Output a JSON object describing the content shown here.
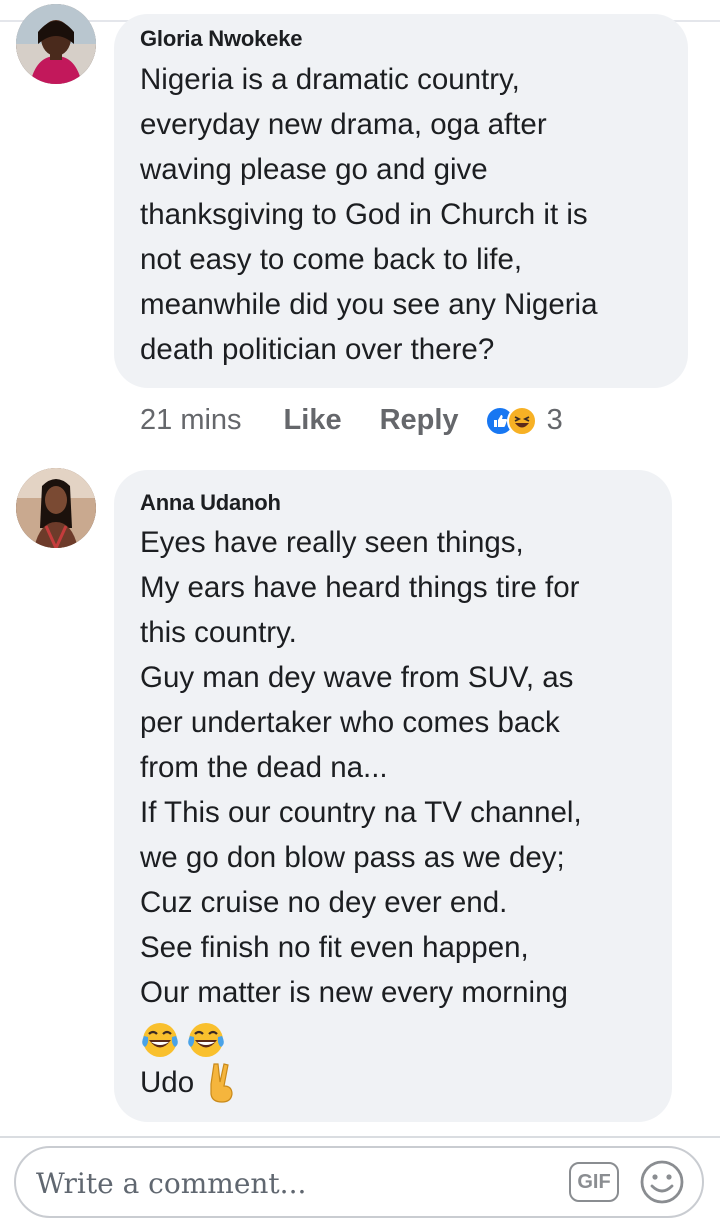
{
  "comments": [
    {
      "author": "Gloria Nwokeke",
      "text": "Nigeria is a dramatic country,\neveryday new drama, oga after\nwaving please go and give\nthanksgiving to God in Church it is\nnot easy to come back to life,\nmeanwhile did you see any Nigeria\ndeath politician over there?",
      "time": "21 mins",
      "like_label": "Like",
      "reply_label": "Reply",
      "reaction_count": "3",
      "reactions": [
        "like-icon",
        "haha-icon"
      ]
    },
    {
      "author": "Anna Udanoh",
      "text": "Eyes have really seen things,\nMy ears have heard things tire for\nthis country.\nGuy man dey wave from SUV, as\nper undertaker who comes back\nfrom the dead na...\nIf This our country na TV channel,\nwe go don blow pass as we dey;\nCuz cruise no dey ever end.\nSee finish no fit even happen,\nOur matter is new every morning",
      "emojis": [
        "tears-of-joy-emoji",
        "tears-of-joy-emoji"
      ],
      "signature": "Udo",
      "signature_emoji": "victory-hand-emoji"
    }
  ],
  "composer": {
    "placeholder": "Write a comment...",
    "gif_label": "GIF",
    "emoji_icon": "smiley-icon"
  },
  "colors": {
    "bubble": "#f0f2f5",
    "text": "#1c1e21",
    "meta": "#65676b",
    "like_blue": "#1877f2",
    "haha_yellow": "#f7b125"
  }
}
